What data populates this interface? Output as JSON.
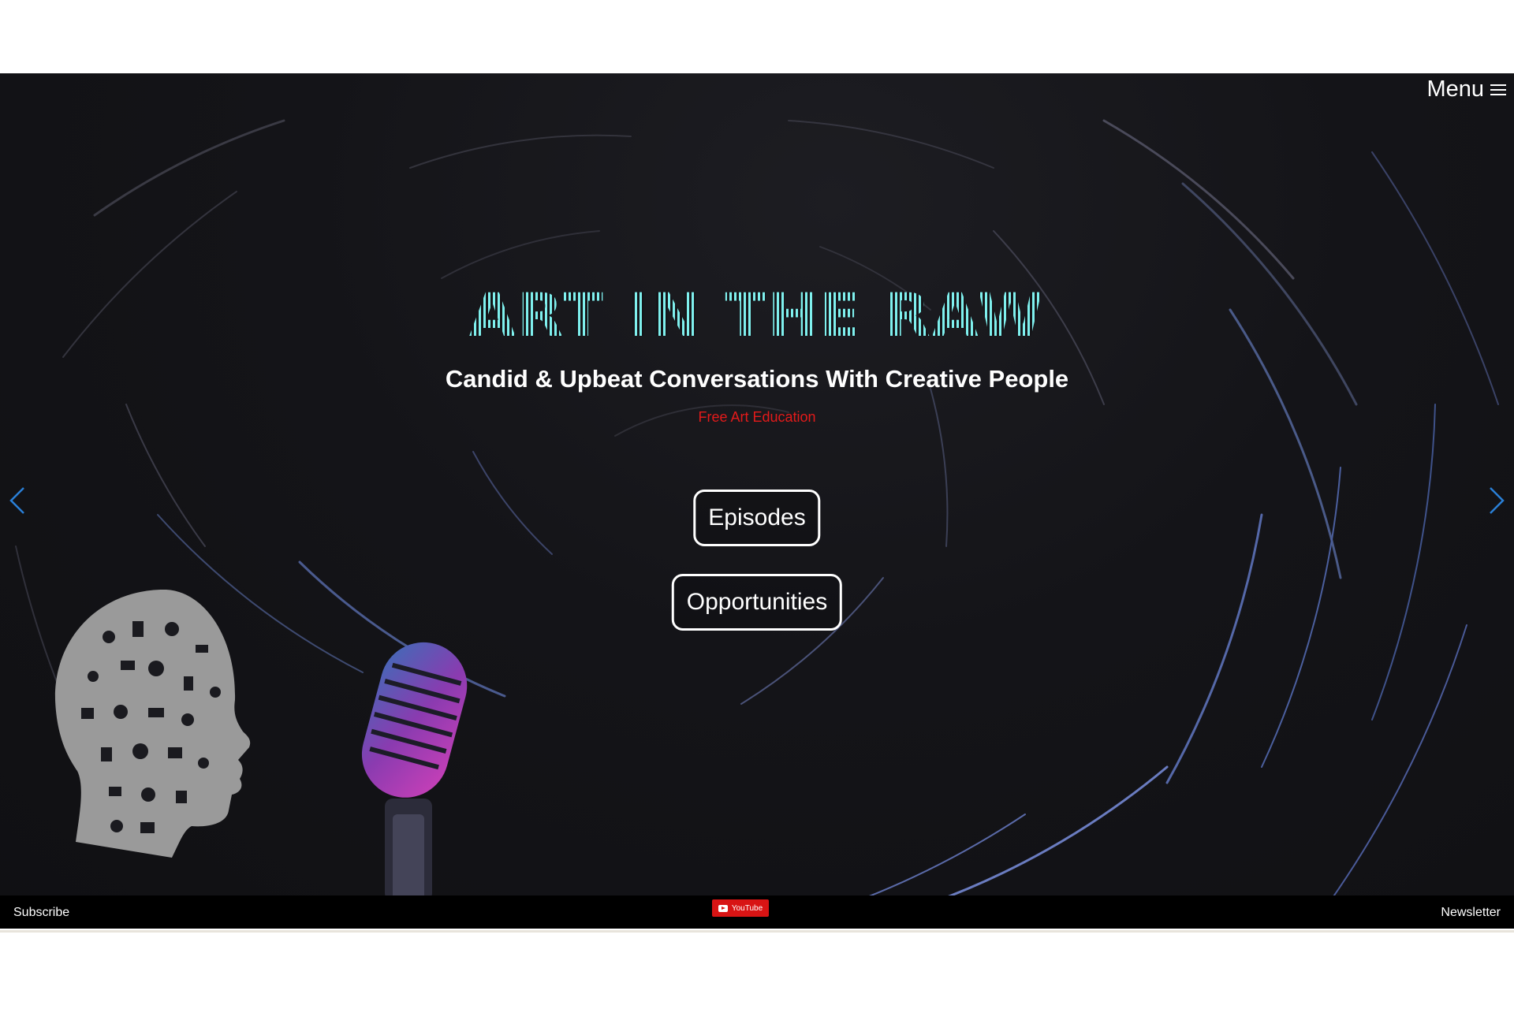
{
  "header": {
    "menu_label": "Menu",
    "menu_icon": "hamburger-icon"
  },
  "hero": {
    "logo_text": "ART IN THE RAW",
    "tagline": "Candid & Upbeat Conversations With Creative People",
    "subtagline": "Free Art Education",
    "buttons": {
      "episodes": "Episodes",
      "opportunities": "Opportunities"
    },
    "prev_icon": "chevron-left-icon",
    "next_icon": "chevron-right-icon",
    "accent_color": "#7ff0ee",
    "subtag_color": "#e31a1a",
    "arrow_color": "#2a7fd6"
  },
  "footer": {
    "subscribe_label": "Subscribe",
    "youtube_label": "YouTube",
    "newsletter_label": "Newsletter",
    "youtube_color": "#d81414"
  }
}
